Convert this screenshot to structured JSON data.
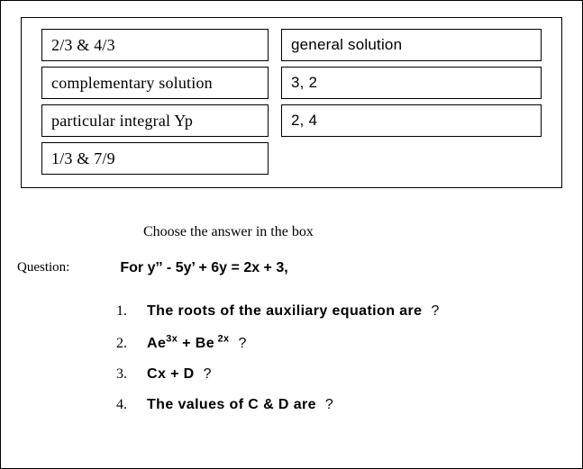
{
  "answers": {
    "left": [
      "2/3 & 4/3",
      "complementary solution",
      "particular integral Yp",
      "1/3 & 7/9"
    ],
    "right": [
      "general solution",
      "3, 2",
      "2, 4"
    ]
  },
  "instruction": "Choose the answer in the box",
  "question_label": "Question:",
  "equation_prefix": "For y",
  "equation_mid1": " - 5y",
  "equation_mid2": " + 6y = 2x + 3,",
  "dprime": "ˮ",
  "prime": "’",
  "items": {
    "n1": "1.",
    "n2": "2.",
    "n3": "3.",
    "n4": "4.",
    "t1a": "The roots of the auxiliary equation are",
    "t2a": "Ae",
    "t2b": "  + Be",
    "t2_sup1": "3x",
    "t2_sup2": " 2x",
    "t3a": "Cx + D",
    "t4a": "The values of C & D are",
    "q": "?"
  }
}
